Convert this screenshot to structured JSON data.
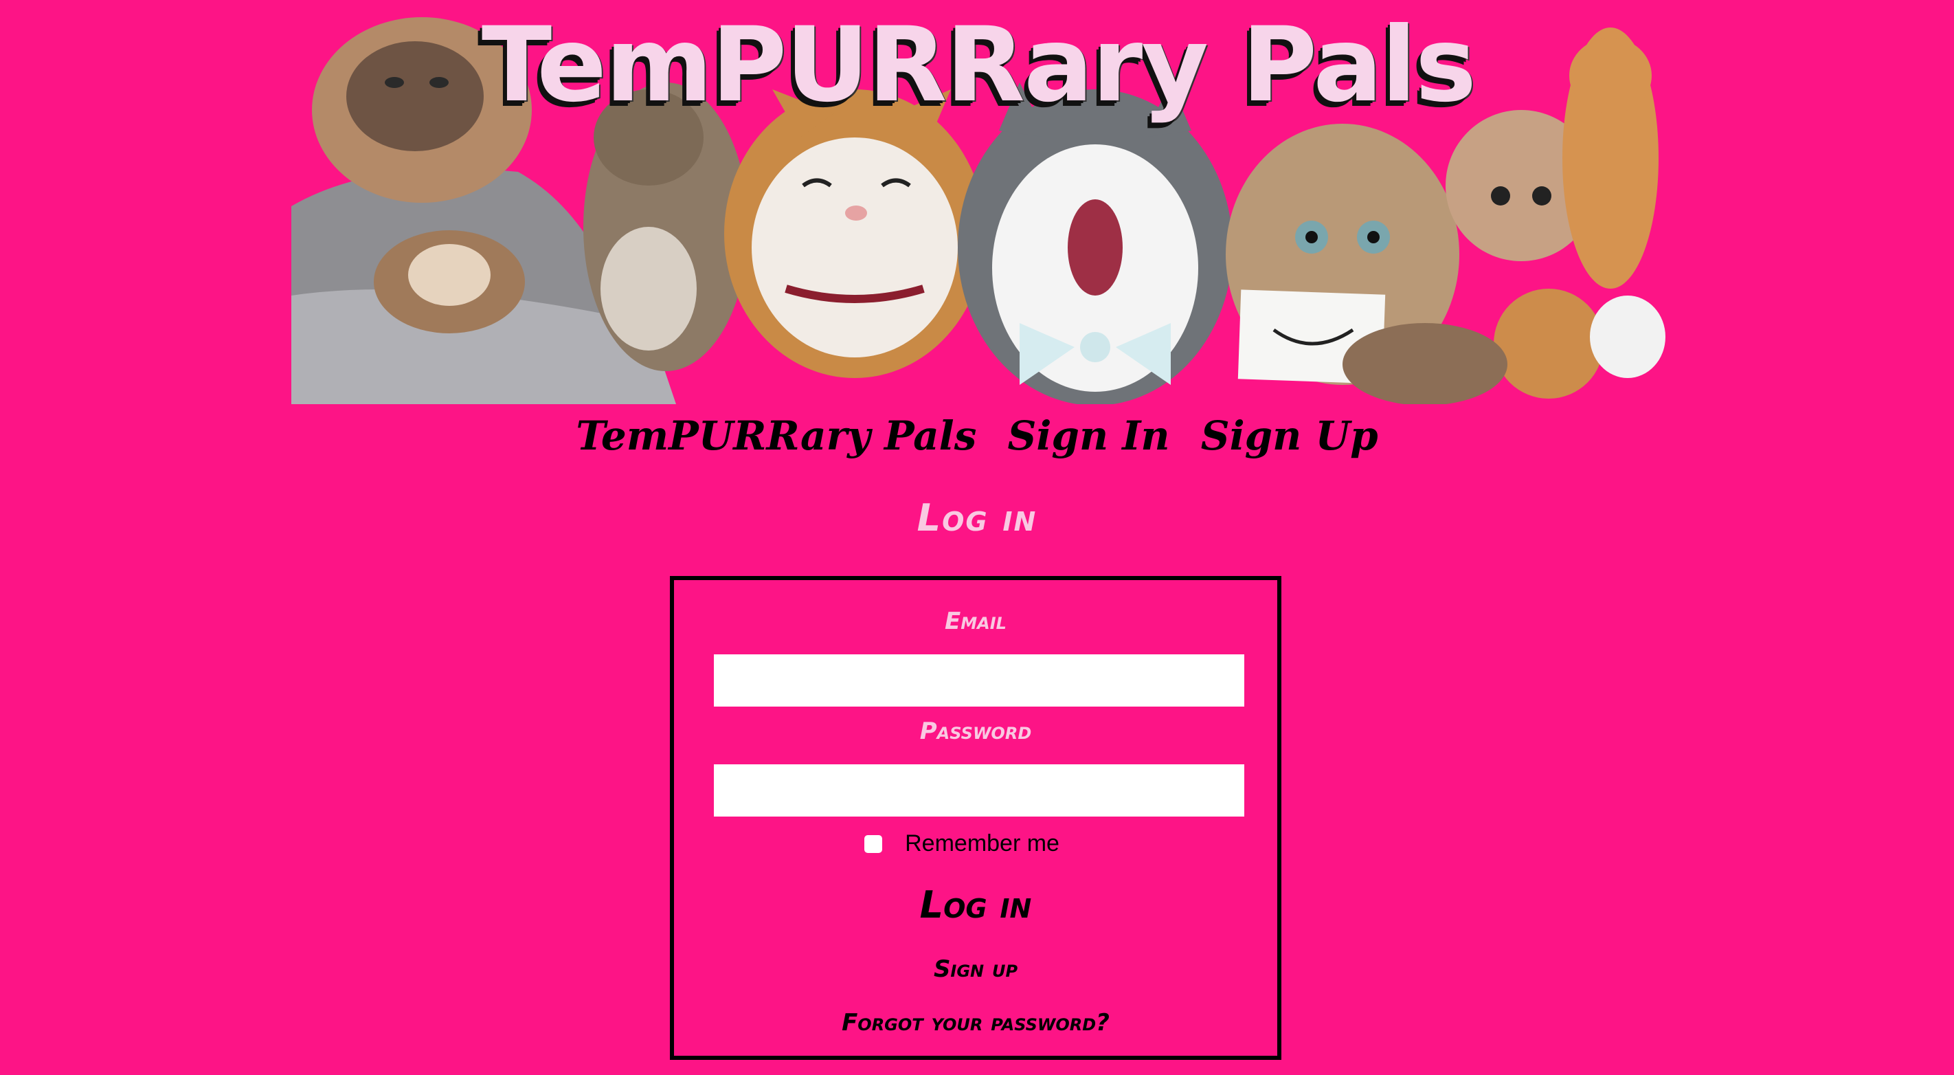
{
  "banner": {
    "title": "TemPURRary Pals",
    "image_icon": "cat-collage-image"
  },
  "nav": {
    "home": "TemPURRary Pals",
    "sign_in": "Sign In",
    "sign_up": "Sign Up"
  },
  "login": {
    "heading": "Log in",
    "email_label": "Email",
    "email_value": "",
    "password_label": "Password",
    "password_value": "",
    "remember_label": "Remember me",
    "remember_checked": false,
    "submit_label": "Log in",
    "signup_link": "Sign up",
    "forgot_link": "Forgot your password?"
  },
  "colors": {
    "background": "#fd1486",
    "label_pink": "#f9c9e2",
    "text": "#000000"
  }
}
